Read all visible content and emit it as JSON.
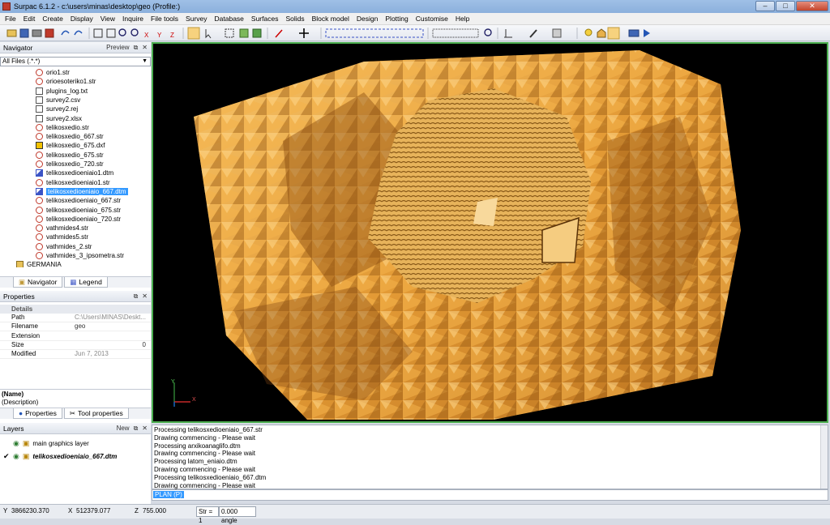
{
  "window": {
    "title": "Surpac 6.1.2 - c:\\users\\minas\\desktop\\geo (Profile:)",
    "minimize": "–",
    "maximize": "□",
    "close": "✕"
  },
  "menu": [
    "File",
    "Edit",
    "Create",
    "Display",
    "View",
    "Inquire",
    "File tools",
    "Survey",
    "Database",
    "Surfaces",
    "Solids",
    "Block model",
    "Design",
    "Plotting",
    "Customise",
    "Help"
  ],
  "navigator": {
    "title": "Navigator",
    "preview_label": "Preview",
    "filter": "All Files (.*.*)",
    "files": [
      {
        "name": "orio1.str",
        "type": "str"
      },
      {
        "name": "orioesoteriko1.str",
        "type": "str"
      },
      {
        "name": "plugins_log.txt",
        "type": "txt"
      },
      {
        "name": "survey2.csv",
        "type": "txt"
      },
      {
        "name": "survey2.rej",
        "type": "txt"
      },
      {
        "name": "survey2.xlsx",
        "type": "txt"
      },
      {
        "name": "telikosxedio.str",
        "type": "str"
      },
      {
        "name": "telikosxedio_667.str",
        "type": "str"
      },
      {
        "name": "telikosxedio_675.dxf",
        "type": "dxf"
      },
      {
        "name": "telikosxedio_675.str",
        "type": "str"
      },
      {
        "name": "telikosxedio_720.str",
        "type": "str"
      },
      {
        "name": "telikosxedioeniaio1.dtm",
        "type": "dtm"
      },
      {
        "name": "telikosxedioeniaio1.str",
        "type": "str"
      },
      {
        "name": "telikosxedioeniaio_667.dtm",
        "type": "dtm",
        "selected": true
      },
      {
        "name": "telikosxedioeniaio_667.str",
        "type": "str"
      },
      {
        "name": "telikosxedioeniaio_675.str",
        "type": "str"
      },
      {
        "name": "telikosxedioeniaio_720.str",
        "type": "str"
      },
      {
        "name": "vathmides4.str",
        "type": "str"
      },
      {
        "name": "vathmides5.str",
        "type": "str"
      },
      {
        "name": "vathmides_2.str",
        "type": "str"
      },
      {
        "name": "vathmides_3_ipsometra.str",
        "type": "str"
      },
      {
        "name": "GERMANIA",
        "type": "folder"
      }
    ],
    "tabs": [
      "Navigator",
      "Legend"
    ]
  },
  "properties": {
    "title": "Properties",
    "section": "Details",
    "rows": [
      {
        "key": "Path",
        "value": "C:\\Users\\MINAS\\Deskt...",
        "grey": true
      },
      {
        "key": "Filename",
        "value": "geo",
        "grey": false
      },
      {
        "key": "Extension",
        "value": "",
        "grey": false
      },
      {
        "key": "Size",
        "value": "0",
        "grey": false
      },
      {
        "key": "Modified",
        "value": "Jun 7, 2013",
        "grey": true
      }
    ],
    "name_label": "(Name)",
    "description_label": "(Description)",
    "tabs": [
      "Properties",
      "Tool properties"
    ]
  },
  "layers": {
    "title": "Layers",
    "new_label": "New",
    "items": [
      {
        "name": "main graphics layer",
        "active": false
      },
      {
        "name": "telikosxedioeniaio_667.dtm",
        "active": true
      }
    ]
  },
  "console": {
    "lines": [
      "Processing telikosxedioeniaio_667.str",
      "Drawing commencing - Please wait",
      "Processing arxikoanaglifo.dtm",
      "Drawing commencing - Please wait",
      "Processing latom_eniaio.dtm",
      "Drawing commencing - Please wait",
      "Processing telikosxedioeniaio_667.dtm",
      "Drawing commencing - Please wait"
    ],
    "prompt": "PLAN (P)"
  },
  "viewport": {
    "axes": {
      "y": "Y",
      "x": "X"
    },
    "surface_color": "#e8a640",
    "background": "#000000",
    "border_color": "#4caf50"
  },
  "status": {
    "y_label": "Y",
    "y": "3866230.370",
    "x_label": "X",
    "x": "512379.077",
    "z_label": "Z",
    "z": "755.000",
    "str": "Str = 1",
    "angle": "0.000 angle"
  }
}
